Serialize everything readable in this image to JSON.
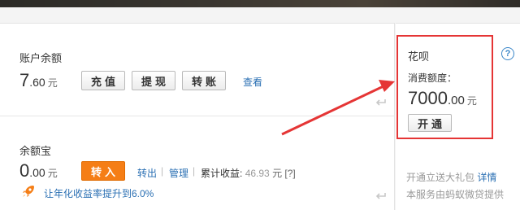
{
  "balance": {
    "title": "账户余额",
    "amount_int": "7",
    "amount_dec": ".60",
    "unit": "元",
    "buttons": [
      "充值",
      "提现",
      "转账"
    ],
    "view_link": "查看"
  },
  "yuebao": {
    "title": "余额宝",
    "amount_int": "0",
    "amount_dec": ".00",
    "unit": "元",
    "transfer_in": "转入",
    "transfer_out": "转出",
    "manage": "管理",
    "earnings_label": "累计收益:",
    "earnings_value": "46.93",
    "earnings_unit": "元",
    "earnings_hint": "[?]",
    "promo": "让年化收益率提升到6.0%"
  },
  "huabei": {
    "title": "花呗",
    "limit_label": "消费额度：",
    "amount_int": "7000",
    "amount_dec": ".00",
    "unit": "元",
    "open_button": "开通",
    "help": "?",
    "gift_text": "开通立送大礼包",
    "gift_link": "详情",
    "provider_text": "本服务由蚂蚁微贷提供"
  },
  "colors": {
    "accent_orange": "#f57e16",
    "link_blue": "#2a6fb3",
    "highlight_red": "#e53535"
  }
}
